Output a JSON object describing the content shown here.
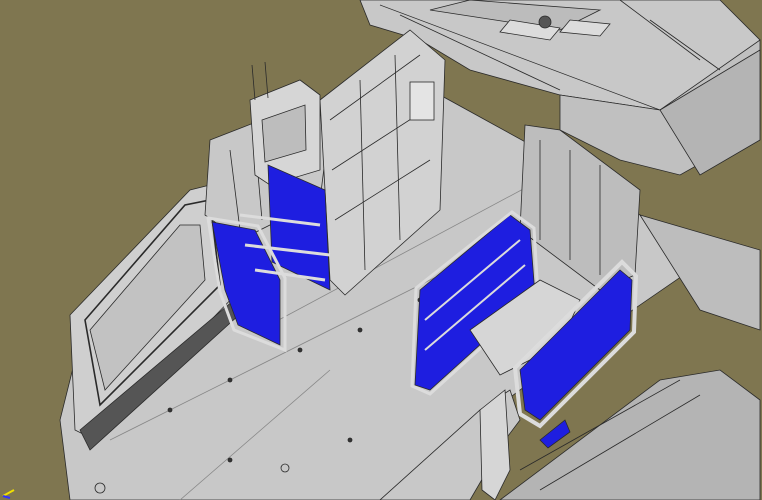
{
  "viewport": {
    "kind": "3D CAD model view",
    "background_color": "#7f7650",
    "panel_fill_color": "#c8c8c8",
    "panel_shade_color": "#b4b4b4",
    "edge_color": "#2a2a2a",
    "highlight_color": "#1e1ee0",
    "frame_metal_color": "#dcdcdc"
  },
  "axis_triad": {
    "icon": "coordinate-axis-triad-icon",
    "colors": [
      "#f0e000",
      "#3030ff"
    ]
  }
}
